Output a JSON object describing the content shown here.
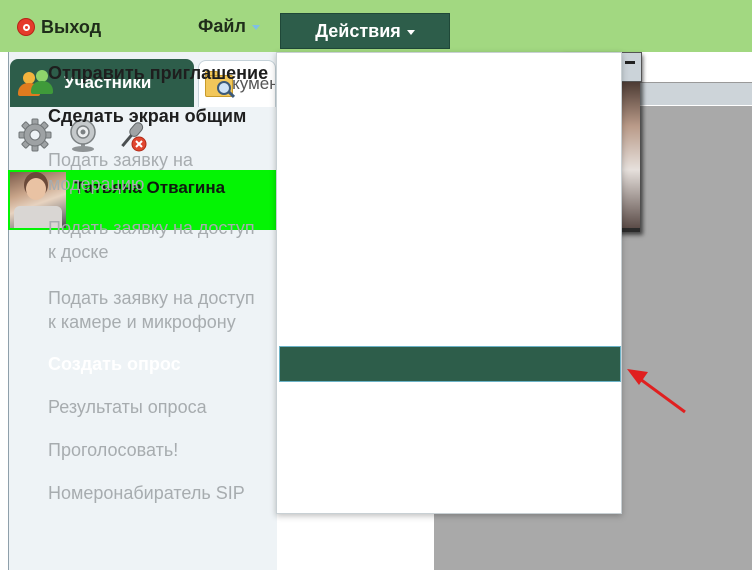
{
  "menubar": {
    "exit_label": "Выход",
    "file_label": "Файл",
    "actions_label": "Действия"
  },
  "tabs": {
    "participants_label": "Участники",
    "docs_label": "Документы"
  },
  "participants": [
    {
      "name": "Татьяна Отвагина"
    }
  ],
  "actions_menu": {
    "items": [
      {
        "label": "Отправить приглашение",
        "enabled": true
      },
      {
        "label": "Сделать экран общим",
        "enabled": true
      },
      {
        "label": "Подать заявку на модерацию",
        "line1": "Подать заявку на",
        "line2": "модерацию",
        "enabled": false
      },
      {
        "label": "Подать заявку на доступ к доске",
        "line1": "Подать заявку на доступ",
        "line2": "к доске",
        "enabled": false
      },
      {
        "label": "Подать заявку на доступ к камере и микрофону",
        "line1": "Подать заявку на доступ",
        "line2": "к камере и микрофону",
        "enabled": false
      },
      {
        "label": "Создать опрос",
        "enabled": true,
        "highlighted": true
      },
      {
        "label": "Результаты опроса",
        "enabled": false
      },
      {
        "label": "Проголосовать!",
        "enabled": false
      },
      {
        "label": "Номеронабиратель SIP",
        "enabled": false
      }
    ]
  },
  "colors": {
    "menubar_bg": "#a2d881",
    "accent": "#2d5d4a",
    "participant_highlight": "#04f404",
    "annotation_arrow": "#e02020"
  },
  "icons": [
    "exit-icon",
    "users-icon",
    "folder-search-icon",
    "gear-icon",
    "webcam-icon",
    "mic-muted-icon",
    "annotation-arrow-icon"
  ]
}
